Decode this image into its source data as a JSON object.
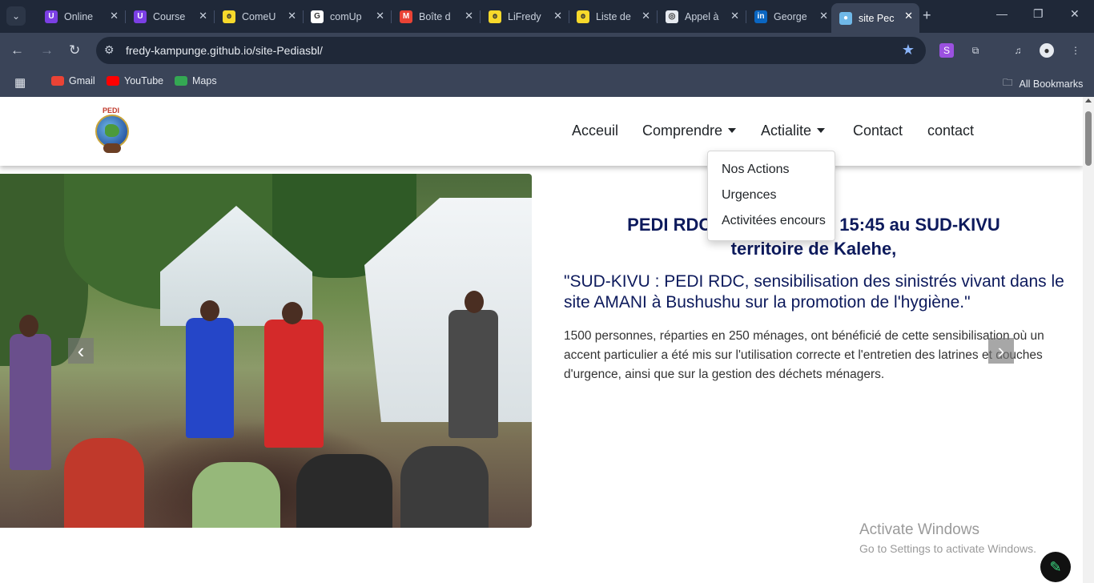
{
  "browser": {
    "tabs": [
      {
        "title": "Online",
        "favicon_color": "#7b3fe4",
        "favicon_glyph": "U"
      },
      {
        "title": "Course",
        "favicon_color": "#7b3fe4",
        "favicon_glyph": "U"
      },
      {
        "title": "ComeU",
        "favicon_color": "#f7d92b",
        "favicon_glyph": "ꙩ"
      },
      {
        "title": "comUp",
        "favicon_color": "#ffffff",
        "favicon_glyph": "G"
      },
      {
        "title": "Boîte d",
        "favicon_color": "#ea4335",
        "favicon_glyph": "M"
      },
      {
        "title": "LiFredy",
        "favicon_color": "#f7d92b",
        "favicon_glyph": "ꙩ"
      },
      {
        "title": "Liste de",
        "favicon_color": "#f7d92b",
        "favicon_glyph": "ꙩ"
      },
      {
        "title": "Appel à",
        "favicon_color": "#e6eaf0",
        "favicon_glyph": "◎"
      },
      {
        "title": "George",
        "favicon_color": "#0a66c2",
        "favicon_glyph": "in"
      },
      {
        "title": "site Pec",
        "favicon_color": "#6fb8e8",
        "favicon_glyph": "●",
        "active": true
      }
    ],
    "url": "fredy-kampunge.github.io/site-Pediasbl/",
    "bookmarks": [
      {
        "label": "Gmail",
        "color": "#ea4335"
      },
      {
        "label": "YouTube",
        "color": "#ff0000"
      },
      {
        "label": "Maps",
        "color": "#34a853"
      }
    ],
    "all_bookmarks": "All Bookmarks"
  },
  "site": {
    "logo_text": "PEDI",
    "nav": [
      {
        "label": "Acceuil",
        "dropdown": false
      },
      {
        "label": "Comprendre",
        "dropdown": true
      },
      {
        "label": "Actialite",
        "dropdown": true
      },
      {
        "label": "Contact",
        "dropdown": false
      },
      {
        "label": "contact",
        "dropdown": false
      }
    ],
    "dropdown_items": [
      "Nos Actions",
      "Urgences",
      "Activitées encours"
    ],
    "headline_line1_left": "PEDI RDC",
    "headline_line1_right": "15:45 au SUD-KIVU",
    "headline_line2": "territoire de Kalehe,",
    "subheadline": "\"SUD-KIVU : PEDI RDC, sensibilisation des sinistrés vivant dans le site AMANI à Bushushu sur la promotion de l'hygiène.\"",
    "body": "1500 personnes, réparties en 250 ménages, ont bénéficié de cette sensibilisation où un accent particulier a été mis sur l'utilisation correcte et l'entretien des latrines et douches d'urgence, ainsi que sur la gestion des déchets ménagers."
  },
  "overlay": {
    "activate_title": "Activate Windows",
    "activate_sub": "Go to Settings to activate Windows."
  }
}
